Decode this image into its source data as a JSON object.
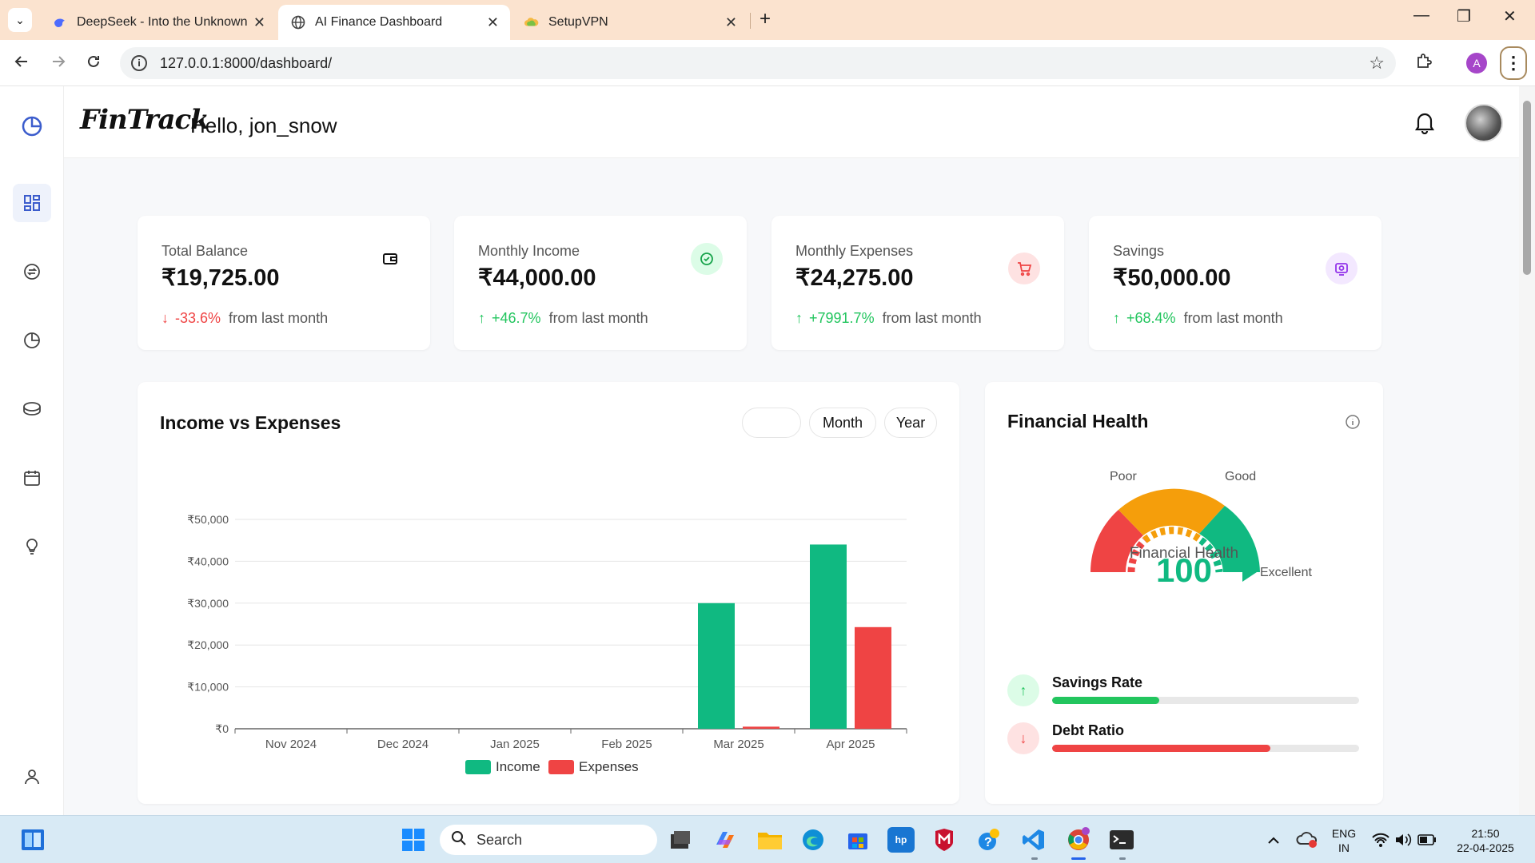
{
  "browser": {
    "tabs": [
      {
        "title": "DeepSeek - Into the Unknown",
        "close": "✕"
      },
      {
        "title": "AI Finance Dashboard",
        "close": "✕"
      },
      {
        "title": "SetupVPN",
        "close": "✕"
      }
    ],
    "new_tab": "+",
    "url": "127.0.0.1:8000/dashboard/",
    "profile_initial": "A",
    "menu": "⋮",
    "window_controls": {
      "minimize": "—",
      "restore": "❐",
      "close": "✕"
    }
  },
  "app": {
    "logo": "FinTrack",
    "greeting": "Hello, jon_snow",
    "accent": "#3b5ccc"
  },
  "sidebar": {
    "icons": [
      "pie-chart-icon",
      "dashboard-icon",
      "exchange-icon",
      "analytics-icon",
      "coins-icon",
      "calendar-icon",
      "lightbulb-icon",
      "user-icon"
    ]
  },
  "stats": [
    {
      "title": "Total Balance",
      "value": "₹19,725.00",
      "change": "-33.6%",
      "direction": "down",
      "from": "from last month",
      "icon": "wallet-icon"
    },
    {
      "title": "Monthly Income",
      "value": "₹44,000.00",
      "change": "+46.7%",
      "direction": "up",
      "from": "from last month",
      "icon": "check-circle-icon"
    },
    {
      "title": "Monthly Expenses",
      "value": "₹24,275.00",
      "change": "+7991.7%",
      "direction": "up",
      "from": "from last month",
      "icon": "cart-icon"
    },
    {
      "title": "Savings",
      "value": "₹50,000.00",
      "change": "+68.4%",
      "direction": "up",
      "from": "from last month",
      "icon": "piggy-icon"
    }
  ],
  "chart_section": {
    "title": "Income vs Expenses",
    "filters": [
      "",
      "Month",
      "Year"
    ]
  },
  "chart_data": {
    "type": "bar",
    "categories": [
      "Nov 2024",
      "Dec 2024",
      "Jan 2025",
      "Feb 2025",
      "Mar 2025",
      "Apr 2025"
    ],
    "series": [
      {
        "name": "Income",
        "values": [
          0,
          0,
          0,
          0,
          30000,
          44000
        ],
        "color": "#10b981"
      },
      {
        "name": "Expenses",
        "values": [
          0,
          0,
          0,
          0,
          500,
          24275
        ],
        "color": "#ef4444"
      }
    ],
    "yticks": [
      "₹0",
      "₹10,000",
      "₹20,000",
      "₹30,000",
      "₹40,000",
      "₹50,000"
    ],
    "ylim": [
      0,
      50000
    ],
    "grid": true,
    "legend": "bottom"
  },
  "health": {
    "title": "Financial Health",
    "gauge_labels": {
      "poor": "Poor",
      "good": "Good",
      "excellent": "Excellent"
    },
    "gauge_center_label": "Financial Health",
    "score": "100",
    "score_value": 100,
    "metrics": [
      {
        "label": "Savings Rate",
        "fill": 0.35,
        "color": "#22c55e",
        "direction": "up"
      },
      {
        "label": "Debt Ratio",
        "fill": 0.71,
        "color": "#ef4444",
        "direction": "down"
      }
    ]
  },
  "taskbar": {
    "search": "Search",
    "lang_top": "ENG",
    "lang_bottom": "IN",
    "time": "21:50",
    "date": "22-04-2025"
  }
}
